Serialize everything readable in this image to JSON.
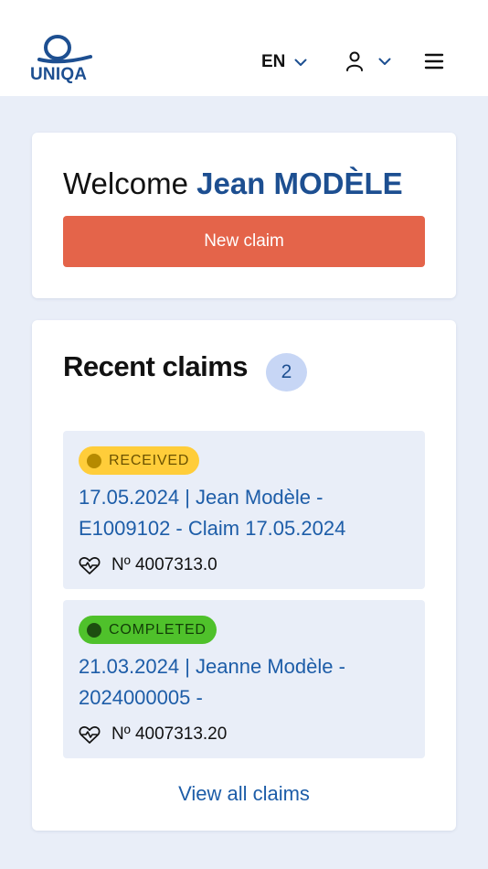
{
  "header": {
    "logo_text": "UNIQA",
    "language": "EN",
    "icons": [
      "chevron-down-icon",
      "user-icon",
      "hamburger-menu-icon"
    ]
  },
  "welcome": {
    "greeting": "Welcome",
    "name": "Jean MODÈLE",
    "new_claim_label": "New claim"
  },
  "recent": {
    "title": "Recent claims",
    "count": "2",
    "claims": [
      {
        "status": "RECEIVED",
        "title": "17.05.2024 | Jean Modèle - E1009102 - Claim 17.05.2024",
        "policy": "Nº 4007313.0",
        "icon": "heart-pulse-icon"
      },
      {
        "status": "COMPLETED",
        "title": "21.03.2024 | Jeanne Modèle - 2024000005 -",
        "policy": "Nº 4007313.20",
        "icon": "heart-pulse-icon"
      }
    ],
    "view_all_label": "View all claims"
  },
  "colors": {
    "brand_blue": "#1d4f91",
    "link_blue": "#1d5da8",
    "primary_button": "#e4644a",
    "background": "#e9eef8",
    "received_badge": "#ffcd3a",
    "completed_badge": "#4fc12b"
  }
}
